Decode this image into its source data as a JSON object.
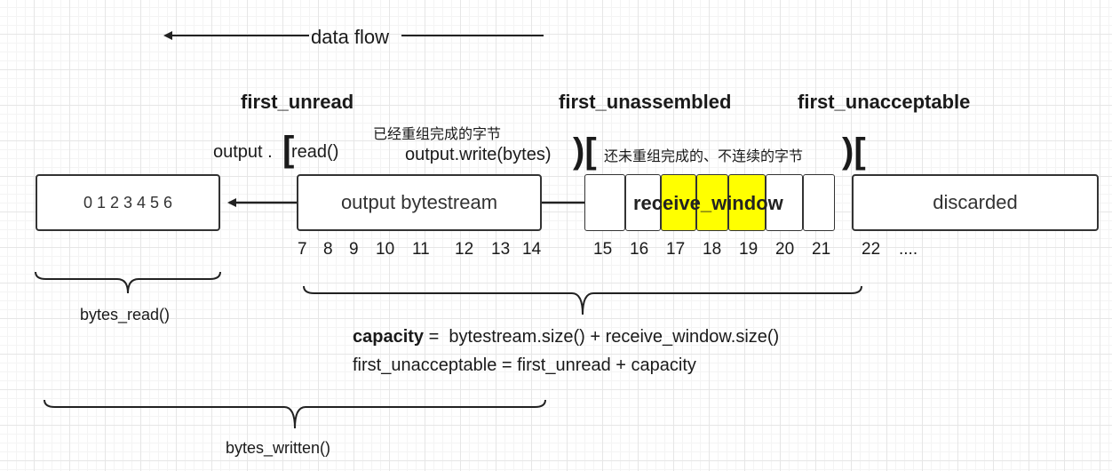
{
  "data_flow": "data flow",
  "labels": {
    "first_unread": "first_unread",
    "first_unassembled": "first_unassembled",
    "first_unacceptable": "first_unacceptable"
  },
  "annotations": {
    "output_read_prefix": "output .",
    "output_read_suffix": "read()",
    "output_write": "output.write(bytes)",
    "assembled_bytes": "已经重组完成的字节",
    "unassembled_bytes": "还未重组完成的、不连续的字节"
  },
  "brackets": {
    "left": "[",
    "close_open": ")["
  },
  "boxes": {
    "read_bytes": "0 1 2 3 4 5 6",
    "output_bytestream": "output bytestream",
    "receive_window": "receive_window",
    "discarded": "discarded"
  },
  "highlight_color": "#ffff00",
  "indices": [
    "7",
    "8",
    "9",
    "10",
    "11",
    "12",
    "13",
    "14",
    "15",
    "16",
    "17",
    "18",
    "19",
    "20",
    "21",
    "22",
    "...."
  ],
  "braces": {
    "bytes_read": "bytes_read()",
    "bytes_written": "bytes_written()"
  },
  "formulas": {
    "capacity_label": "capacity",
    "capacity_expr": " =  bytestream.size() + receive_window.size()",
    "first_unacceptable_expr": "first_unacceptable = first_unread + capacity"
  }
}
